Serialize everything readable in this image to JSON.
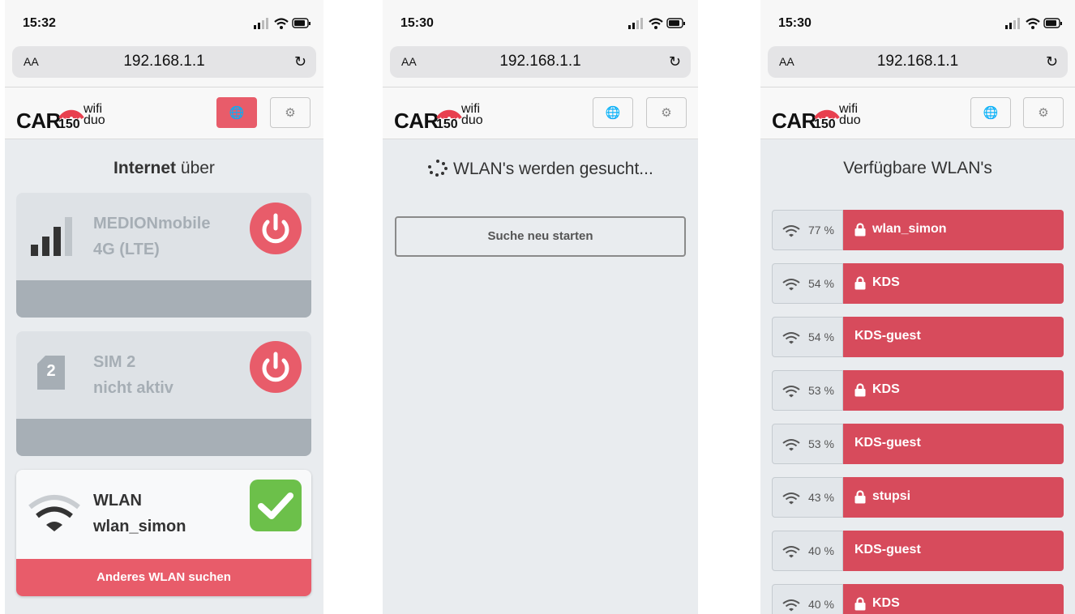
{
  "screens": [
    {
      "status_time": "15:32",
      "url": "192.168.1.1",
      "url_aa": "AA",
      "heading_bold": "Internet",
      "heading_rest": " über",
      "cards": [
        {
          "line1": "MEDIONmobile",
          "line2": "4G (LTE)"
        },
        {
          "line1": "SIM 2",
          "line2": "nicht aktiv",
          "sim_number": "2"
        },
        {
          "line1": "WLAN",
          "line2": "wlan_simon",
          "action": "Anderes WLAN suchen"
        }
      ]
    },
    {
      "status_time": "15:30",
      "url": "192.168.1.1",
      "url_aa": "AA",
      "searching": "WLAN's werden gesucht...",
      "restart_label": "Suche neu starten"
    },
    {
      "status_time": "15:30",
      "url": "192.168.1.1",
      "url_aa": "AA",
      "heading": "Verfügbare WLAN's",
      "networks": [
        {
          "signal": "77 %",
          "name": "wlan_simon",
          "locked": true
        },
        {
          "signal": "54 %",
          "name": "KDS",
          "locked": true
        },
        {
          "signal": "54 %",
          "name": "KDS-guest",
          "locked": false
        },
        {
          "signal": "53 %",
          "name": "KDS",
          "locked": true
        },
        {
          "signal": "53 %",
          "name": "KDS-guest",
          "locked": false
        },
        {
          "signal": "43 %",
          "name": "stupsi",
          "locked": true
        },
        {
          "signal": "40 %",
          "name": "KDS-guest",
          "locked": false
        },
        {
          "signal": "40 %",
          "name": "KDS",
          "locked": true
        }
      ]
    }
  ],
  "logo": {
    "car": "CAR",
    "num": "150",
    "wifi": "wifi",
    "duo": "duo"
  },
  "colors": {
    "accent": "#e85c6a",
    "list_red": "#d74b5c",
    "success": "#6cc04a",
    "inactive": "#a6aeb5"
  }
}
